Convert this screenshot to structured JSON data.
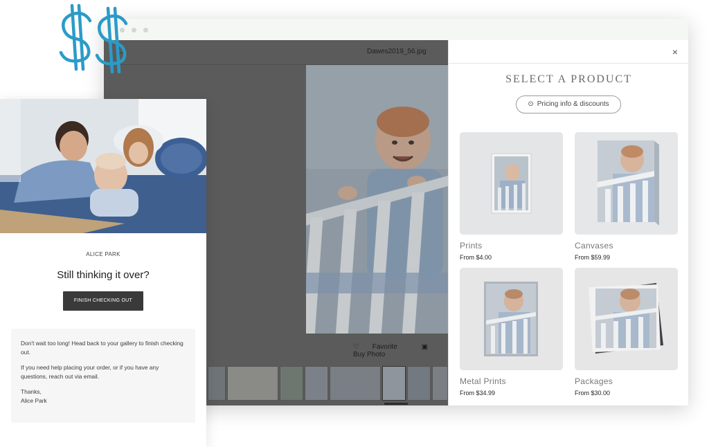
{
  "viewer": {
    "filename": "Dawes2019_56.jpg",
    "back_icon": "←",
    "favorite_label": "Favorite",
    "buy_photo_label": "Buy Photo"
  },
  "panel": {
    "title": "SELECT A PRODUCT",
    "pricing_label": "Pricing info & discounts",
    "close_icon": "×",
    "products": [
      {
        "name": "Prints",
        "price": "From $4.00"
      },
      {
        "name": "Canvases",
        "price": "From $59.99"
      },
      {
        "name": "Metal Prints",
        "price": "From $34.99"
      },
      {
        "name": "Packages",
        "price": "From $30.00"
      }
    ]
  },
  "email": {
    "sender": "ALICE PARK",
    "headline": "Still thinking it over?",
    "button": "FINISH CHECKING OUT",
    "paragraph1": "Don't wait too long! Head back to your gallery to finish checking out.",
    "paragraph2": "If you need help placing your order, or if you have any questions, reach out via email.",
    "signoff": "Thanks,",
    "signature": "Alice Park"
  },
  "colors": {
    "accent_dollar": "#2b9bc8",
    "viewer_bg": "#5b5b5b",
    "button_dark": "#3a3a3a"
  }
}
